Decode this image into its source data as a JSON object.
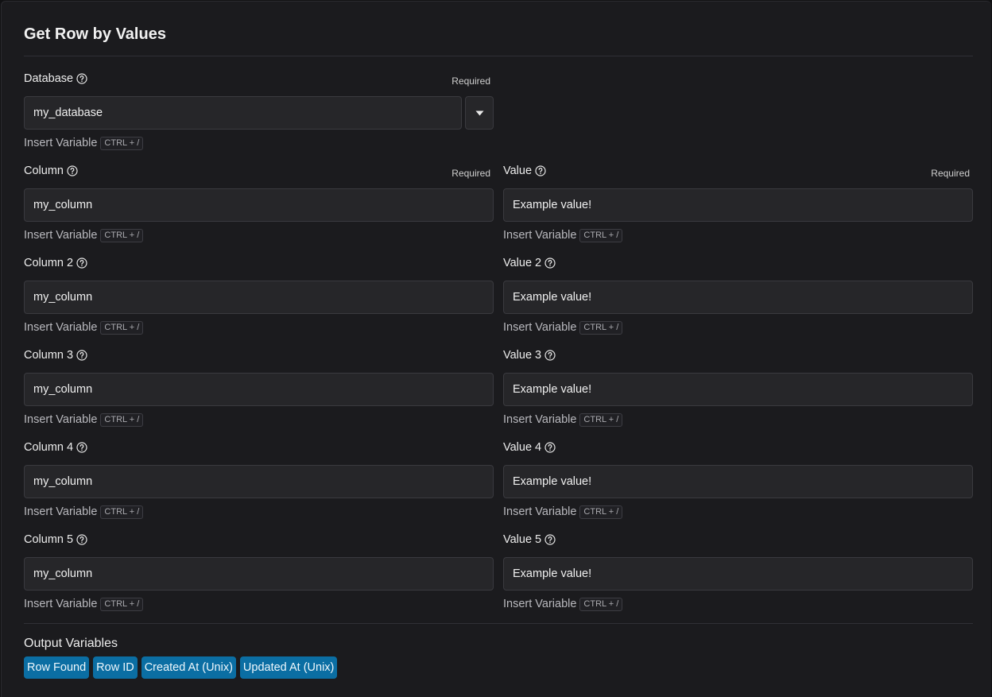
{
  "page": {
    "title": "Get Row by Values"
  },
  "database": {
    "label": "Database",
    "required": "Required",
    "value": "my_database",
    "insert_variable": "Insert Variable",
    "shortcut": "CTRL + /"
  },
  "fields": [
    {
      "column": {
        "label": "Column",
        "required": "Required",
        "value": "my_column",
        "insert_variable": "Insert Variable",
        "shortcut": "CTRL + /"
      },
      "value": {
        "label": "Value",
        "required": "Required",
        "value": "Example value!",
        "insert_variable": "Insert Variable",
        "shortcut": "CTRL + /"
      }
    },
    {
      "column": {
        "label": "Column 2",
        "value": "my_column",
        "insert_variable": "Insert Variable",
        "shortcut": "CTRL + /"
      },
      "value": {
        "label": "Value 2",
        "value": "Example value!",
        "insert_variable": "Insert Variable",
        "shortcut": "CTRL + /"
      }
    },
    {
      "column": {
        "label": "Column 3",
        "value": "my_column",
        "insert_variable": "Insert Variable",
        "shortcut": "CTRL + /"
      },
      "value": {
        "label": "Value 3",
        "value": "Example value!",
        "insert_variable": "Insert Variable",
        "shortcut": "CTRL + /"
      }
    },
    {
      "column": {
        "label": "Column 4",
        "value": "my_column",
        "insert_variable": "Insert Variable",
        "shortcut": "CTRL + /"
      },
      "value": {
        "label": "Value 4",
        "value": "Example value!",
        "insert_variable": "Insert Variable",
        "shortcut": "CTRL + /"
      }
    },
    {
      "column": {
        "label": "Column 5",
        "value": "my_column",
        "insert_variable": "Insert Variable",
        "shortcut": "CTRL + /"
      },
      "value": {
        "label": "Value 5",
        "value": "Example value!",
        "insert_variable": "Insert Variable",
        "shortcut": "CTRL + /"
      }
    }
  ],
  "output": {
    "title": "Output Variables",
    "chips": [
      "Row Found",
      "Row ID",
      "Created At (Unix)",
      "Updated At (Unix)"
    ]
  },
  "icons": {
    "help": "question-circle-icon",
    "dropdown": "caret-down-icon"
  },
  "colors": {
    "background": "#1b1b1e",
    "input_background": "#262629",
    "chip_background": "#0b6ea3",
    "text": "#ececec"
  }
}
